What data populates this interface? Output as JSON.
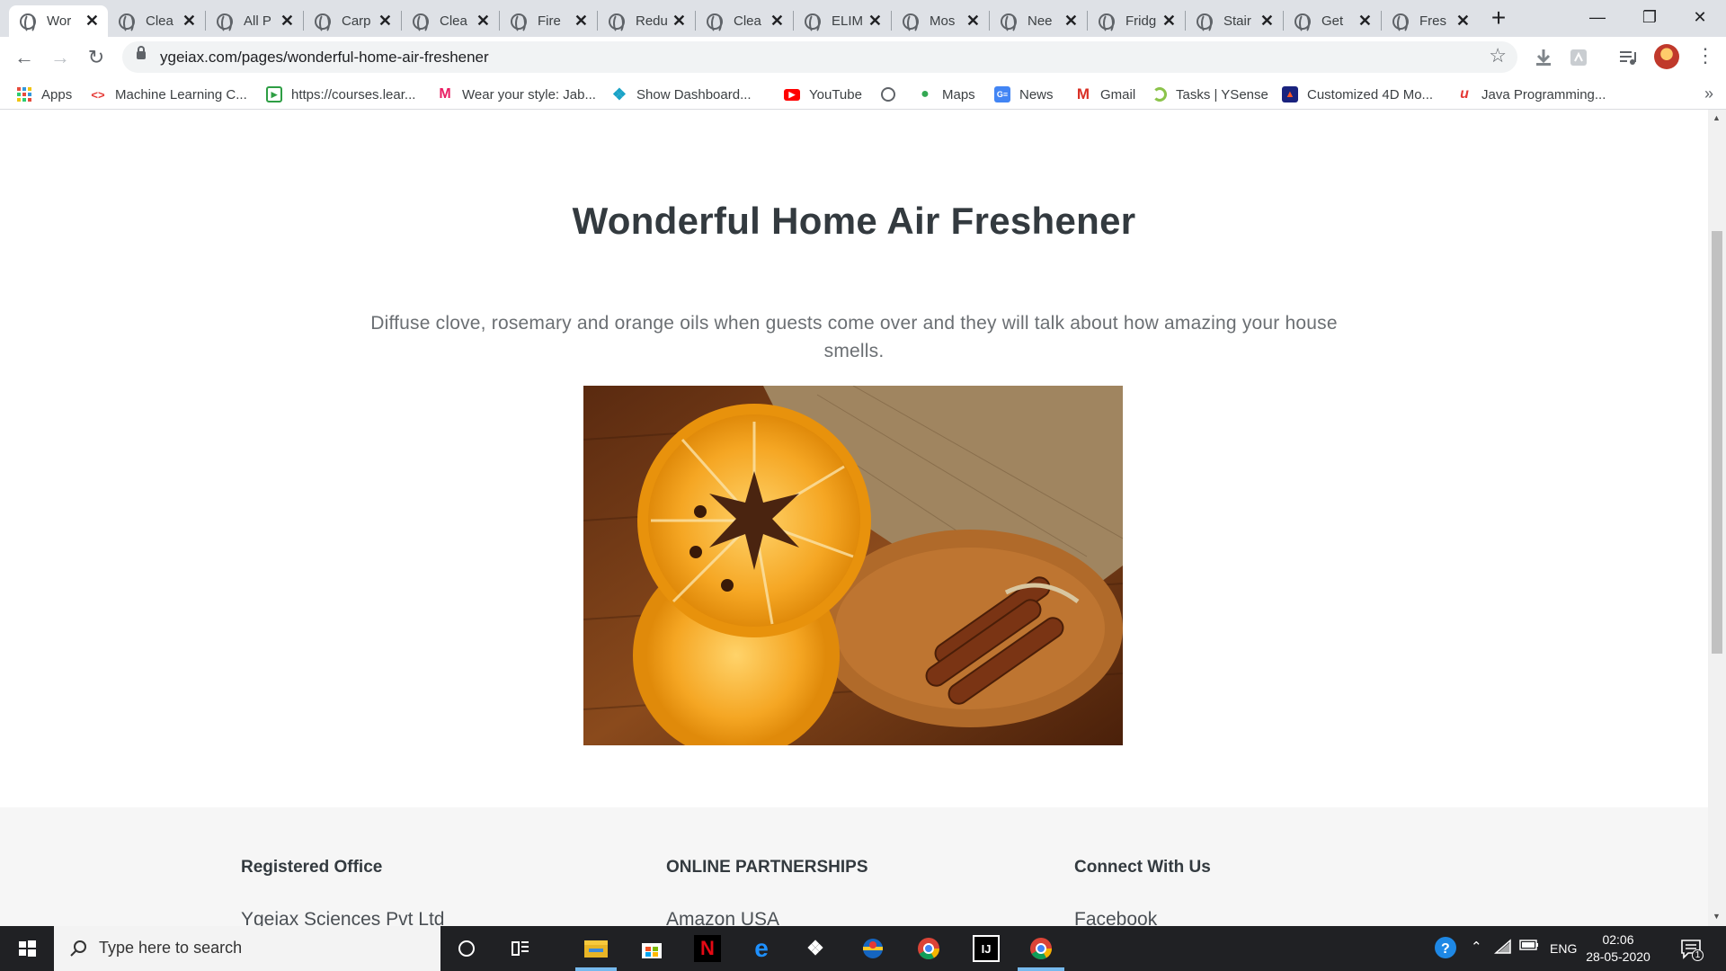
{
  "browser": {
    "tabs": [
      {
        "label": "Wor",
        "active": true
      },
      {
        "label": "Clea"
      },
      {
        "label": "All P"
      },
      {
        "label": "Carp"
      },
      {
        "label": "Clea"
      },
      {
        "label": "Fire"
      },
      {
        "label": "Redu"
      },
      {
        "label": "Clea"
      },
      {
        "label": "ELIM"
      },
      {
        "label": "Mos"
      },
      {
        "label": "Nee"
      },
      {
        "label": "Fridg"
      },
      {
        "label": "Stair"
      },
      {
        "label": "Get"
      },
      {
        "label": "Fres"
      }
    ],
    "url": "ygeiax.com/pages/wonderful-home-air-freshener",
    "bookmarks": [
      {
        "label": "Apps",
        "icon": "apps-grid-icon"
      },
      {
        "label": "Machine Learning C...",
        "icon": "ml-icon"
      },
      {
        "label": "https://courses.lear...",
        "icon": "courses-icon"
      },
      {
        "label": "Wear your style: Jab...",
        "icon": "myntra-icon"
      },
      {
        "label": "Show Dashboard...",
        "icon": "dashboard-icon"
      },
      {
        "label": "YouTube",
        "icon": "youtube-icon"
      },
      {
        "label": "",
        "icon": "globe-icon"
      },
      {
        "label": "Maps",
        "icon": "maps-icon"
      },
      {
        "label": "News",
        "icon": "news-icon"
      },
      {
        "label": "Gmail",
        "icon": "gmail-icon"
      },
      {
        "label": "Tasks | YSense",
        "icon": "ysense-icon"
      },
      {
        "label": "Customized 4D Mo...",
        "icon": "4d-icon"
      },
      {
        "label": "Java Programming...",
        "icon": "java-icon"
      }
    ]
  },
  "page": {
    "title": "Wonderful Home Air Freshener",
    "description": "Diffuse clove, rosemary and orange oils when guests come over and they will talk about how amazing your house smells.",
    "image": "orange-slices-star-anise-cinnamon-photo"
  },
  "footer": {
    "columns": [
      {
        "heading": "Registered Office",
        "first_line": "Ygeiax Sciences Pvt Ltd"
      },
      {
        "heading": "ONLINE PARTNERSHIPS",
        "first_line": "Amazon USA"
      },
      {
        "heading": "Connect With Us",
        "first_line": "Facebook"
      }
    ]
  },
  "taskbar": {
    "search_placeholder": "Type here to search",
    "language": "ENG",
    "time": "02:06",
    "date": "28-05-2020",
    "notification_count": "1"
  },
  "colors": {
    "tabstrip": "#dee1e6",
    "footer_bg": "#f6f6f6",
    "taskbar": "#202124",
    "title_text": "#333a3f"
  }
}
